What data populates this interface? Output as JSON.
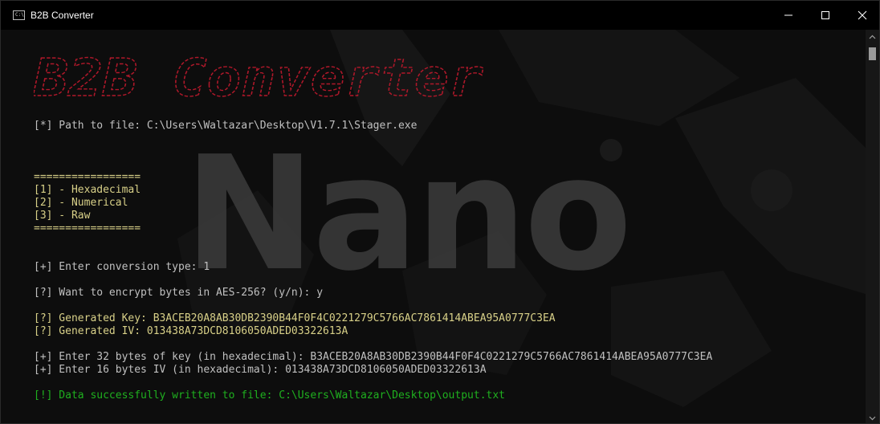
{
  "window": {
    "title": "B2B Converter",
    "app_icon_text": "C:\\",
    "controls": [
      "minimize-icon",
      "maximize-icon",
      "close-icon"
    ]
  },
  "background": {
    "watermark_text": "Nano",
    "watermark_color": "#3b3b3b"
  },
  "banner": {
    "text": "B2B Converter",
    "color": "#b0182a"
  },
  "console": {
    "path_line": "[*] Path to file: C:\\Users\\Waltazar\\Desktop\\V1.7.1\\Stager.exe",
    "menu_separator_top": "=================",
    "menu_options": [
      "[1] - Hexadecimal",
      "[2] - Numerical",
      "[3] - Raw"
    ],
    "menu_separator_bottom": "=================",
    "conversion_prompt": "[+] Enter conversion type: 1",
    "encrypt_prompt": "[?] Want to encrypt bytes in AES-256? (y/n): y",
    "generated_key": "[?] Generated Key: B3ACEB20A8AB30DB2390B44F0F4C0221279C5766AC7861414ABEA95A0777C3EA",
    "generated_iv": "[?] Generated IV: 013438A73DCD8106050ADED03322613A",
    "enter_key": "[+] Enter 32 bytes of key (in hexadecimal): B3ACEB20A8AB30DB2390B44F0F4C0221279C5766AC7861414ABEA95A0777C3EA",
    "enter_iv": "[+] Enter 16 bytes IV (in hexadecimal): 013438A73DCD8106050ADED03322613A",
    "success": "[!] Data successfully written to file: C:\\Users\\Waltazar\\Desktop\\output.txt"
  },
  "colors": {
    "text_default": "#c0c0c0",
    "text_yellow": "#d8d088",
    "text_green": "#1fb01f",
    "banner_red": "#b0182a"
  }
}
